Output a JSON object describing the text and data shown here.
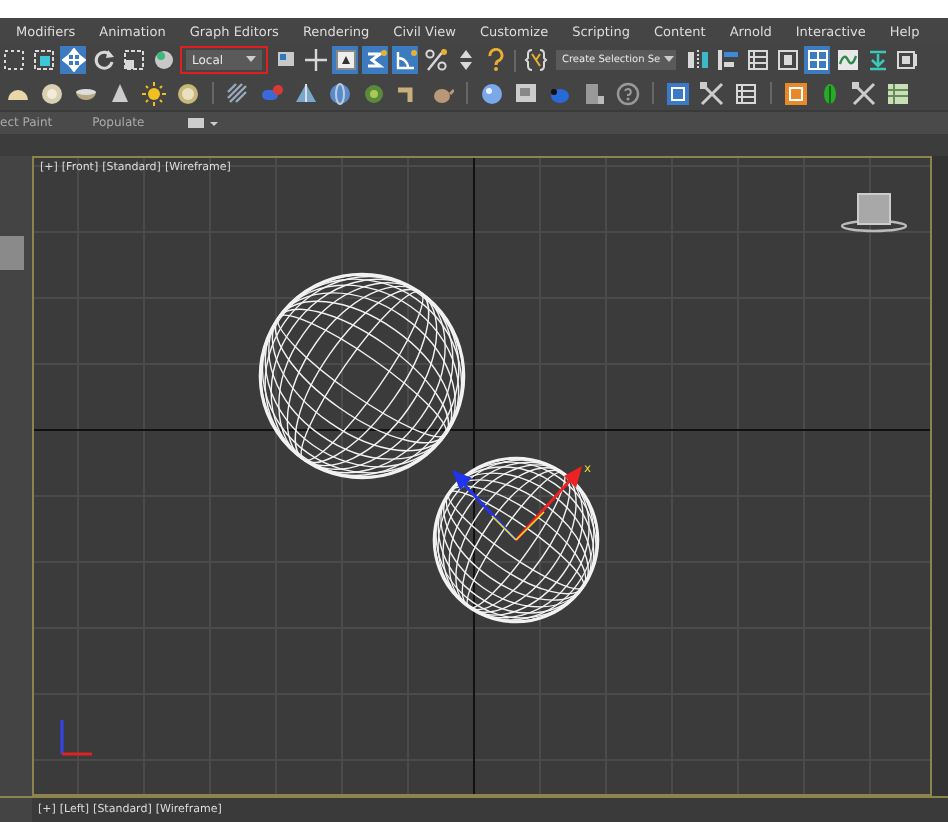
{
  "menu": [
    "Modifiers",
    "Animation",
    "Graph Editors",
    "Rendering",
    "Civil View",
    "Customize",
    "Scripting",
    "Content",
    "Arnold",
    "Interactive",
    "Help"
  ],
  "toolbar": {
    "buttons_left": [
      {
        "selected": false
      },
      {
        "selected": false
      },
      {
        "selected": true
      },
      {
        "selected": false
      },
      {
        "selected": false
      },
      {
        "selected": false
      }
    ],
    "coordinate_dropdown": {
      "value": "Local"
    },
    "buttons_middle": [
      {
        "selected": false
      },
      {
        "selected": false
      },
      {
        "selected": true
      },
      {
        "selected": true
      },
      {
        "selected": true
      },
      {
        "selected": false
      },
      {
        "selected": false
      },
      {
        "selected": false
      },
      {
        "selected": false
      }
    ],
    "selection_set_dropdown": {
      "value": "Create Selection Se"
    },
    "buttons_right": [
      {
        "selected": false
      },
      {
        "selected": false
      },
      {
        "selected": false
      },
      {
        "selected": false
      },
      {
        "selected": true
      },
      {
        "selected": false
      },
      {
        "selected": false
      },
      {
        "selected": false
      }
    ]
  },
  "command_tabs": [
    "ect Paint",
    "Populate"
  ],
  "front_viewport": {
    "labels": [
      "[+]",
      "[Front]",
      "[Standard]",
      "[Wireframe]"
    ],
    "gizmo_label": "x"
  },
  "left_viewport": {
    "labels": [
      "[+]",
      "[Left]",
      "[Standard]",
      "[Wireframe]"
    ]
  }
}
